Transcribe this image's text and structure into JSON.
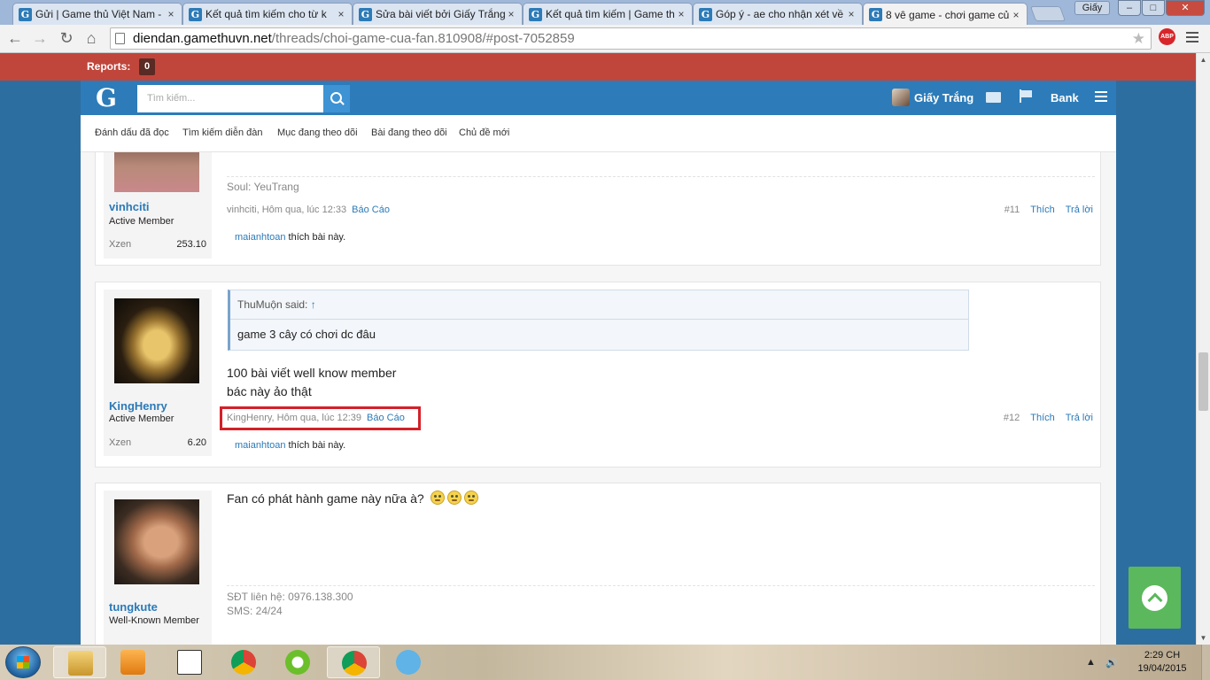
{
  "browser": {
    "tabs": [
      {
        "label": "Gửi | Game thủ Việt Nam - ",
        "favicon": "G",
        "close": "×"
      },
      {
        "label": "Kết quả tìm kiếm cho từ k",
        "favicon": "G",
        "close": "×"
      },
      {
        "label": "Sửa bài viết bởi Giấy Trắng",
        "favicon": "G",
        "close": "×"
      },
      {
        "label": "Kết quả tìm kiếm | Game th",
        "favicon": "G",
        "close": "×"
      },
      {
        "label": "Góp ý - ae cho nhận xét về",
        "favicon": "G",
        "close": "×"
      },
      {
        "label": "8 vê game - chơi game củ",
        "favicon": "G",
        "close": "×"
      }
    ],
    "user_badge": "Giấy",
    "url_host": "diendan.gamethuvn.net",
    "url_path": "/threads/choi-game-cua-fan.810908/#post-7052859",
    "abp": "ABP"
  },
  "reports": {
    "label": "Reports:",
    "count": "0"
  },
  "header": {
    "logo": "G",
    "search_placeholder": "Tìm kiếm...",
    "username": "Giấy Trắng",
    "bank": "Bank"
  },
  "subnav": [
    "Đánh dấu đã đọc",
    "Tìm kiếm diễn đàn",
    "Mục đang theo dõi",
    "Bài đang theo dõi",
    "Chủ đề mới"
  ],
  "posts": [
    {
      "username": "vinhciti",
      "user_title": "Active Member",
      "xzen_label": "Xzen",
      "xzen": "253.10",
      "signature": "Soul: YeuTrang",
      "meta": "vinhciti, Hôm qua, lúc 12:33",
      "report": "Báo Cáo",
      "num": "#11",
      "like": "Thích",
      "reply": "Trả lời",
      "likes_user": "maianhtoan",
      "likes_text": " thích bài này."
    },
    {
      "username": "KingHenry",
      "user_title": "Active Member",
      "xzen_label": "Xzen",
      "xzen": "6.20",
      "quote_author": "ThuMuộn said:",
      "quote_arrow": "↑",
      "quote_text": "game 3 cây có chơi dc đâu",
      "message_line1": "100 bài viết well know member",
      "message_line2": "bác này ảo thật",
      "meta": "KingHenry, Hôm qua, lúc 12:39",
      "report": "Báo Cáo",
      "num": "#12",
      "like": "Thích",
      "reply": "Trả lời",
      "likes_user": "maianhtoan",
      "likes_text": " thích bài này."
    },
    {
      "username": "tungkute",
      "user_title": "Well-Known Member",
      "message": "Fan có phát hành game này nữa à?",
      "sig_line1": "SĐT liên hệ: 0976.138.300",
      "sig_line2": "SMS: 24/24"
    }
  ],
  "taskbar": {
    "time": "2:29 CH",
    "date": "19/04/2015"
  },
  "colors": {
    "accent": "#2d7cb9",
    "reports_bar": "#c0463b",
    "highlight": "#d42029",
    "scrolltop": "#5cb85c"
  }
}
